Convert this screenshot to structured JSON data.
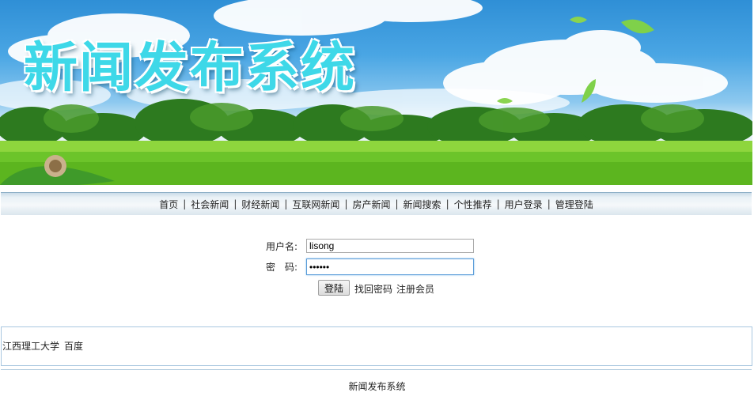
{
  "banner": {
    "title": "新闻发布系统",
    "title_color": "#3ed8e8"
  },
  "nav": {
    "items": [
      {
        "label": "首页"
      },
      {
        "label": "社会新闻"
      },
      {
        "label": "财经新闻"
      },
      {
        "label": "互联网新闻"
      },
      {
        "label": "房产新闻"
      },
      {
        "label": "新闻搜索"
      },
      {
        "label": "个性推荐"
      },
      {
        "label": "用户登录"
      },
      {
        "label": "管理登陆"
      }
    ],
    "separator": "|"
  },
  "login": {
    "username_label": "用户名:",
    "username_value": "lisong",
    "password_label": "密　码:",
    "password_value": "••••••",
    "submit_label": "登陆",
    "forgot_label": "找回密码",
    "register_label": "注册会员"
  },
  "links": {
    "items": [
      {
        "label": "江西理工大学"
      },
      {
        "label": "百度"
      }
    ]
  },
  "footer": {
    "copyright": "新闻发布系统"
  }
}
